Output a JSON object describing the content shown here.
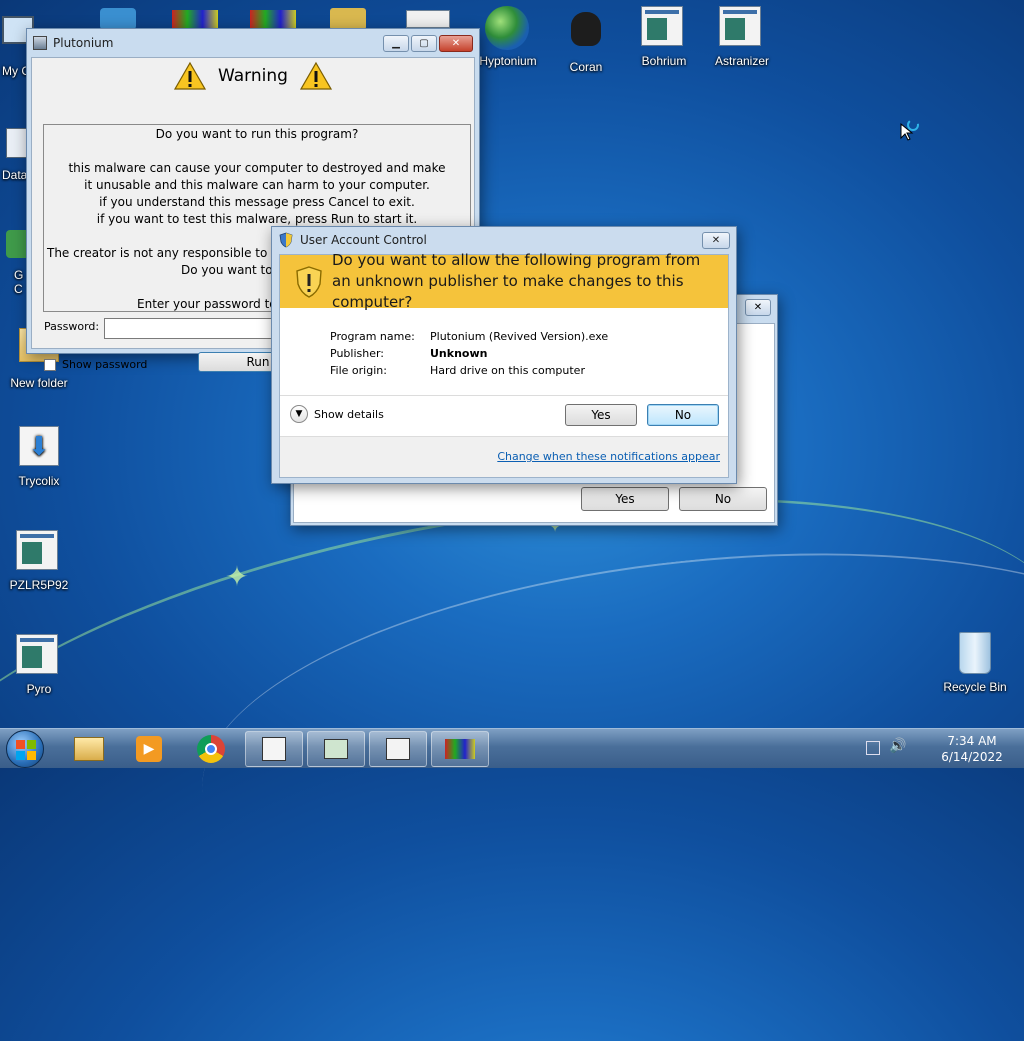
{
  "desktop": {
    "icons": [
      {
        "label": "My C",
        "id": "my-computer"
      },
      {
        "label": "Data",
        "id": "data"
      },
      {
        "label": "G\nC",
        "id": "g-c"
      },
      {
        "label": "Hyptonium",
        "id": "hyptonium"
      },
      {
        "label": "Coran",
        "id": "coran"
      },
      {
        "label": "Bohrium",
        "id": "bohrium"
      },
      {
        "label": "Astranizer",
        "id": "astranizer"
      },
      {
        "label": "New folder",
        "id": "new-folder"
      },
      {
        "label": "Trycolix",
        "id": "trycolix"
      },
      {
        "label": "PZLR5P92",
        "id": "pzlr5p92"
      },
      {
        "label": "Pyro",
        "id": "pyro"
      },
      {
        "label": "Recycle Bin",
        "id": "recycle-bin"
      }
    ]
  },
  "plutonium_window": {
    "title": "Plutonium",
    "heading": "Warning",
    "question": "Do you want to run this program?",
    "lines": [
      "this malware can cause your computer to destroyed and make",
      "it unusable and this malware can harm to your computer.",
      "if you understand this message press Cancel to exit.",
      "if you want to test this malware, press Run to start it."
    ],
    "line_creator": "The creator is not any responsible to make damage make this malware",
    "line_do_you_want": "Do you want to",
    "line_password_prompt": "Enter your password to",
    "password_label": "Password:",
    "password_value": "",
    "show_password_label": "Show password",
    "run_label": "Run"
  },
  "back_dialog": {
    "yes_label": "Yes",
    "no_label": "No"
  },
  "uac": {
    "title": "User Account Control",
    "question": "Do you want to allow the following program from an unknown publisher to make changes to this computer?",
    "program_name_label": "Program name:",
    "program_name_value": "Plutonium (Revived Version).exe",
    "publisher_label": "Publisher:",
    "publisher_value": "Unknown",
    "file_origin_label": "File origin:",
    "file_origin_value": "Hard drive on this computer",
    "show_details_label": "Show details",
    "yes_label": "Yes",
    "no_label": "No",
    "change_link": "Change when these notifications appear",
    "accent_color": "#f5c33b"
  },
  "taskbar": {
    "time": "7:34 AM",
    "date": "6/14/2022"
  }
}
